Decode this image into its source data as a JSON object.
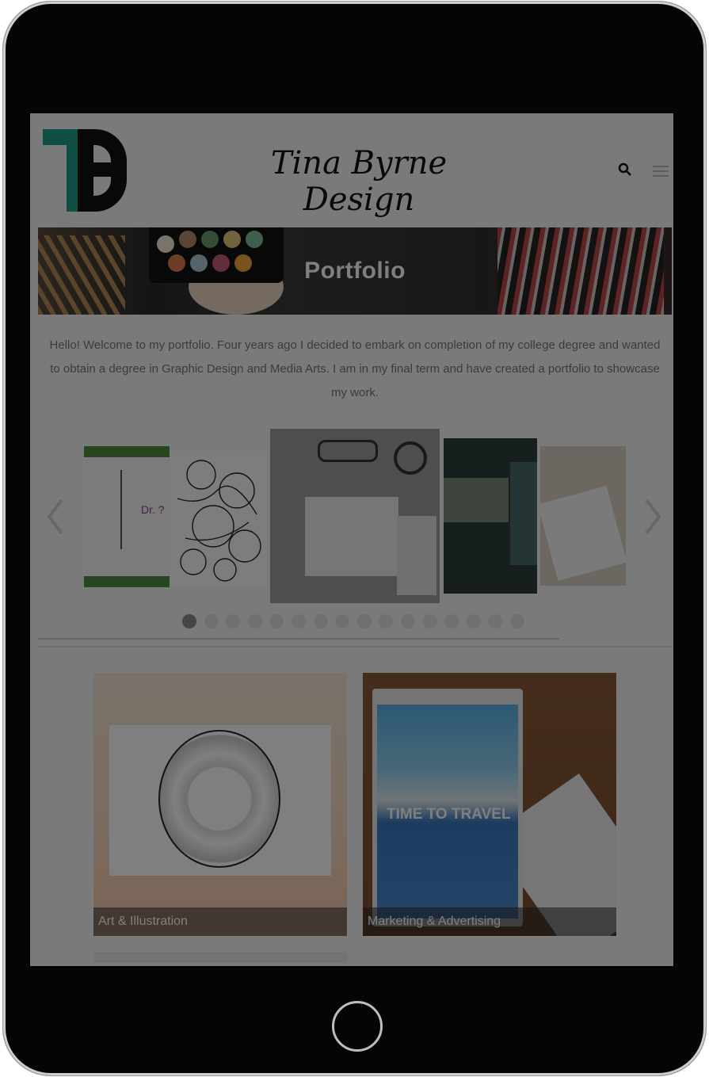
{
  "site": {
    "title": "Tina Byrne Design",
    "logo_text": "TB"
  },
  "header": {
    "search_icon": "search-icon",
    "menu_icon": "hamburger-menu-icon"
  },
  "banner": {
    "title": "Portfolio"
  },
  "intro": {
    "text": "Hello! Welcome to my portfolio. Four years ago I decided to embark on completion of my college degree and wanted to obtain a degree in Graphic Design and Media Arts. I am in my final term and have created a portfolio to showcase my work."
  },
  "carousel": {
    "prev_icon": "chevron-left-icon",
    "next_icon": "chevron-right-icon",
    "slide_count": 16,
    "active_index": 0,
    "slide1_text": "Dr. ?"
  },
  "tiles": [
    {
      "label": "Art & Illustration"
    },
    {
      "label": "Marketing & Advertising",
      "poster_text": "TIME TO TRAVEL"
    }
  ]
}
